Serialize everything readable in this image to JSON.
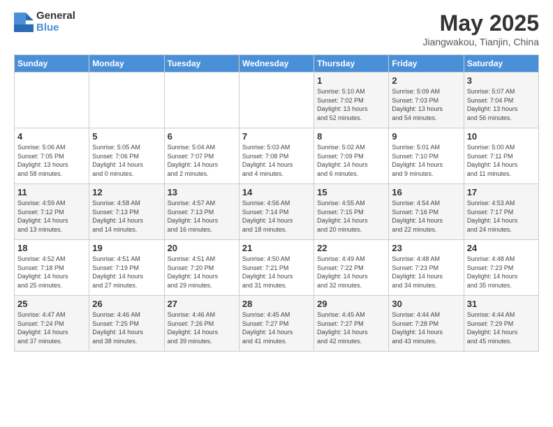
{
  "header": {
    "logo_line1": "General",
    "logo_line2": "Blue",
    "title": "May 2025",
    "subtitle": "Jiangwakou, Tianjin, China"
  },
  "weekdays": [
    "Sunday",
    "Monday",
    "Tuesday",
    "Wednesday",
    "Thursday",
    "Friday",
    "Saturday"
  ],
  "weeks": [
    [
      {
        "day": "",
        "info": ""
      },
      {
        "day": "",
        "info": ""
      },
      {
        "day": "",
        "info": ""
      },
      {
        "day": "",
        "info": ""
      },
      {
        "day": "1",
        "info": "Sunrise: 5:10 AM\nSunset: 7:02 PM\nDaylight: 13 hours\nand 52 minutes."
      },
      {
        "day": "2",
        "info": "Sunrise: 5:09 AM\nSunset: 7:03 PM\nDaylight: 13 hours\nand 54 minutes."
      },
      {
        "day": "3",
        "info": "Sunrise: 5:07 AM\nSunset: 7:04 PM\nDaylight: 13 hours\nand 56 minutes."
      }
    ],
    [
      {
        "day": "4",
        "info": "Sunrise: 5:06 AM\nSunset: 7:05 PM\nDaylight: 13 hours\nand 58 minutes."
      },
      {
        "day": "5",
        "info": "Sunrise: 5:05 AM\nSunset: 7:06 PM\nDaylight: 14 hours\nand 0 minutes."
      },
      {
        "day": "6",
        "info": "Sunrise: 5:04 AM\nSunset: 7:07 PM\nDaylight: 14 hours\nand 2 minutes."
      },
      {
        "day": "7",
        "info": "Sunrise: 5:03 AM\nSunset: 7:08 PM\nDaylight: 14 hours\nand 4 minutes."
      },
      {
        "day": "8",
        "info": "Sunrise: 5:02 AM\nSunset: 7:09 PM\nDaylight: 14 hours\nand 6 minutes."
      },
      {
        "day": "9",
        "info": "Sunrise: 5:01 AM\nSunset: 7:10 PM\nDaylight: 14 hours\nand 9 minutes."
      },
      {
        "day": "10",
        "info": "Sunrise: 5:00 AM\nSunset: 7:11 PM\nDaylight: 14 hours\nand 11 minutes."
      }
    ],
    [
      {
        "day": "11",
        "info": "Sunrise: 4:59 AM\nSunset: 7:12 PM\nDaylight: 14 hours\nand 13 minutes."
      },
      {
        "day": "12",
        "info": "Sunrise: 4:58 AM\nSunset: 7:13 PM\nDaylight: 14 hours\nand 14 minutes."
      },
      {
        "day": "13",
        "info": "Sunrise: 4:57 AM\nSunset: 7:13 PM\nDaylight: 14 hours\nand 16 minutes."
      },
      {
        "day": "14",
        "info": "Sunrise: 4:56 AM\nSunset: 7:14 PM\nDaylight: 14 hours\nand 18 minutes."
      },
      {
        "day": "15",
        "info": "Sunrise: 4:55 AM\nSunset: 7:15 PM\nDaylight: 14 hours\nand 20 minutes."
      },
      {
        "day": "16",
        "info": "Sunrise: 4:54 AM\nSunset: 7:16 PM\nDaylight: 14 hours\nand 22 minutes."
      },
      {
        "day": "17",
        "info": "Sunrise: 4:53 AM\nSunset: 7:17 PM\nDaylight: 14 hours\nand 24 minutes."
      }
    ],
    [
      {
        "day": "18",
        "info": "Sunrise: 4:52 AM\nSunset: 7:18 PM\nDaylight: 14 hours\nand 25 minutes."
      },
      {
        "day": "19",
        "info": "Sunrise: 4:51 AM\nSunset: 7:19 PM\nDaylight: 14 hours\nand 27 minutes."
      },
      {
        "day": "20",
        "info": "Sunrise: 4:51 AM\nSunset: 7:20 PM\nDaylight: 14 hours\nand 29 minutes."
      },
      {
        "day": "21",
        "info": "Sunrise: 4:50 AM\nSunset: 7:21 PM\nDaylight: 14 hours\nand 31 minutes."
      },
      {
        "day": "22",
        "info": "Sunrise: 4:49 AM\nSunset: 7:22 PM\nDaylight: 14 hours\nand 32 minutes."
      },
      {
        "day": "23",
        "info": "Sunrise: 4:48 AM\nSunset: 7:23 PM\nDaylight: 14 hours\nand 34 minutes."
      },
      {
        "day": "24",
        "info": "Sunrise: 4:48 AM\nSunset: 7:23 PM\nDaylight: 14 hours\nand 35 minutes."
      }
    ],
    [
      {
        "day": "25",
        "info": "Sunrise: 4:47 AM\nSunset: 7:24 PM\nDaylight: 14 hours\nand 37 minutes."
      },
      {
        "day": "26",
        "info": "Sunrise: 4:46 AM\nSunset: 7:25 PM\nDaylight: 14 hours\nand 38 minutes."
      },
      {
        "day": "27",
        "info": "Sunrise: 4:46 AM\nSunset: 7:26 PM\nDaylight: 14 hours\nand 39 minutes."
      },
      {
        "day": "28",
        "info": "Sunrise: 4:45 AM\nSunset: 7:27 PM\nDaylight: 14 hours\nand 41 minutes."
      },
      {
        "day": "29",
        "info": "Sunrise: 4:45 AM\nSunset: 7:27 PM\nDaylight: 14 hours\nand 42 minutes."
      },
      {
        "day": "30",
        "info": "Sunrise: 4:44 AM\nSunset: 7:28 PM\nDaylight: 14 hours\nand 43 minutes."
      },
      {
        "day": "31",
        "info": "Sunrise: 4:44 AM\nSunset: 7:29 PM\nDaylight: 14 hours\nand 45 minutes."
      }
    ]
  ]
}
